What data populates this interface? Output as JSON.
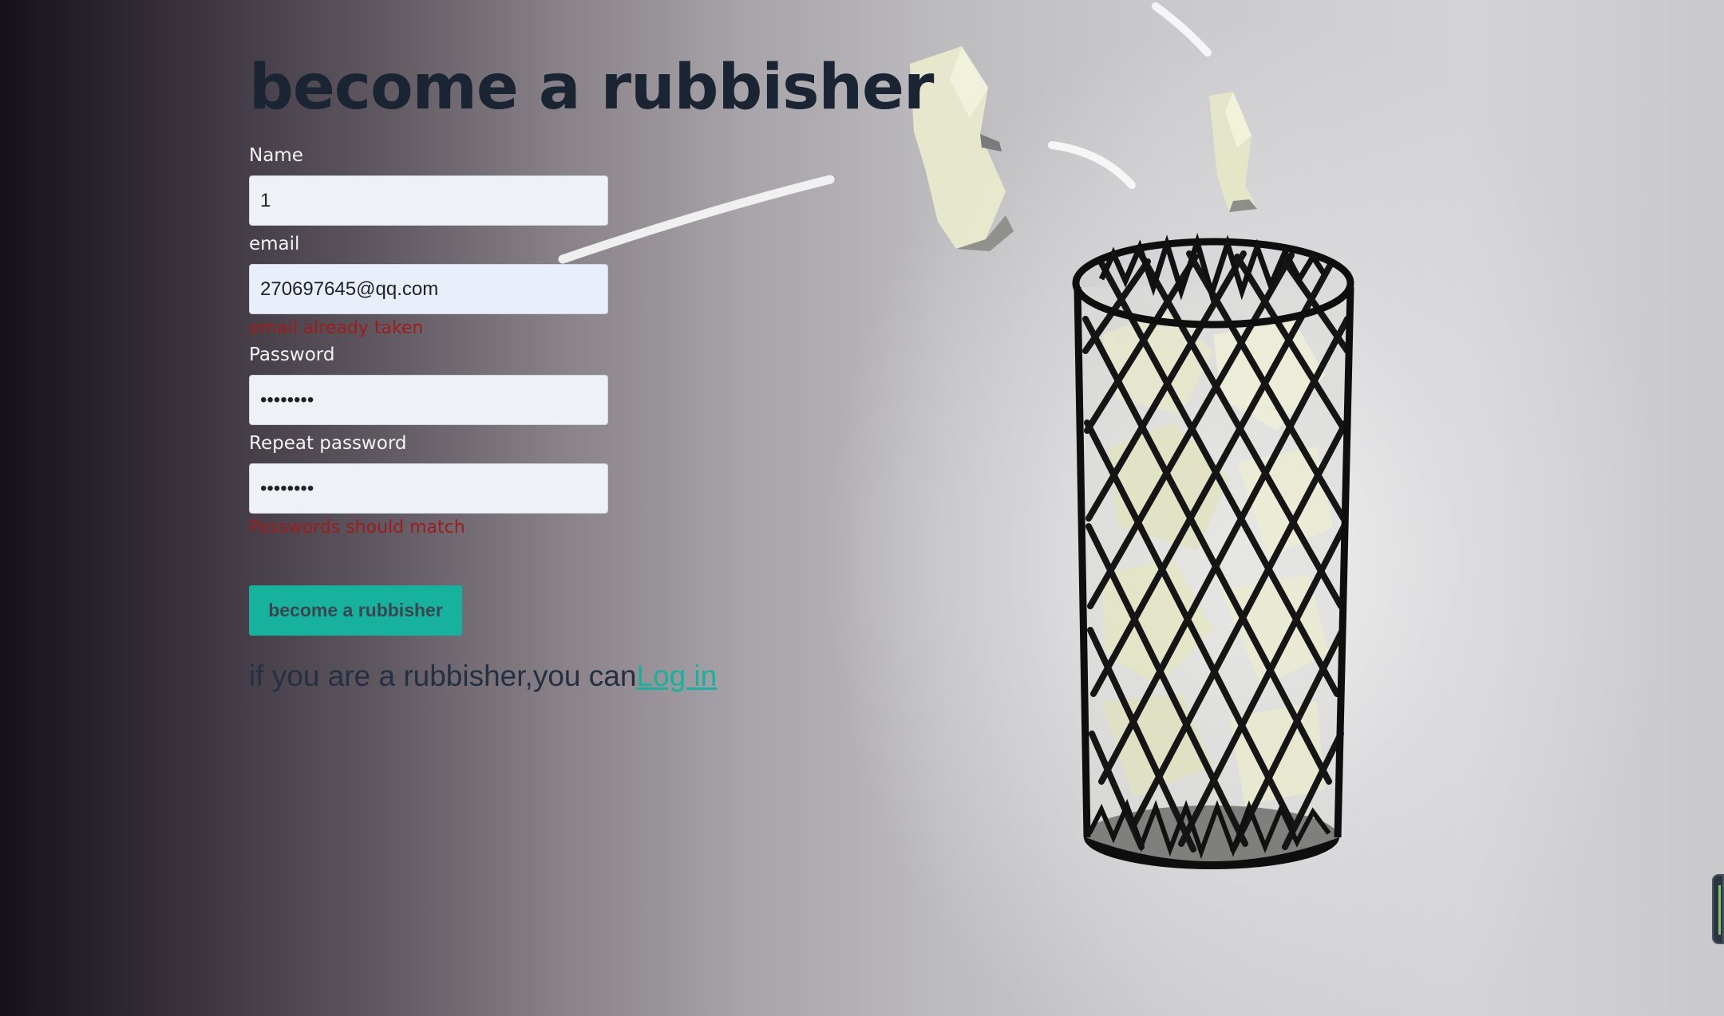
{
  "page": {
    "title": "become a rubbisher"
  },
  "form": {
    "name": {
      "label": "Name",
      "value": "1"
    },
    "email": {
      "label": "email",
      "value": "270697645@qq.com",
      "error": "email already taken"
    },
    "password": {
      "label": "Password",
      "value": "••••••••"
    },
    "repeat_password": {
      "label": "Repeat password",
      "value": "••••••••",
      "error": "Passwords should match"
    },
    "submit_label": "become a rubbisher"
  },
  "footer": {
    "prompt": "if you are a rubbisher,you can",
    "login_link": "Log in"
  },
  "colors": {
    "accent": "#17b29e",
    "error": "#a01c1c",
    "title": "#1a2433"
  },
  "icons": {
    "background": "trash-bin-illustration",
    "handle": "side-panel-handle-icon"
  }
}
